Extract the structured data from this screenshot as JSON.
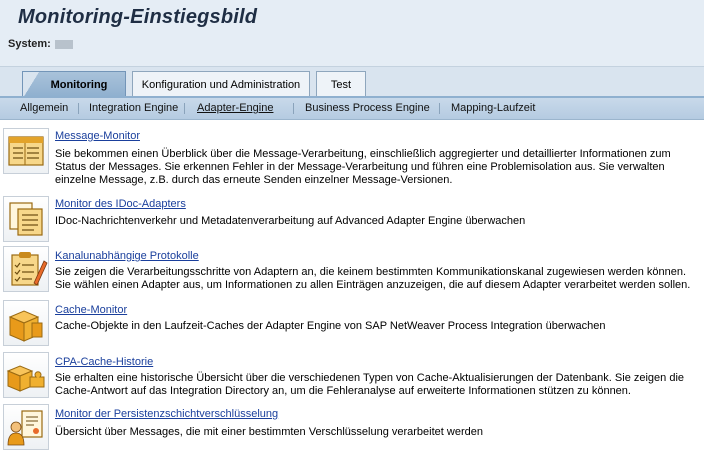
{
  "page": {
    "title": "Monitoring-Einstiegsbild",
    "system_label": "System:",
    "system_value": ""
  },
  "tabs": [
    {
      "label": "Monitoring",
      "active": true
    },
    {
      "label": "Konfiguration und Administration",
      "active": false
    },
    {
      "label": "Test",
      "active": false
    }
  ],
  "subnav": [
    {
      "label": "Allgemein",
      "active": false
    },
    {
      "label": "Integration Engine",
      "active": false
    },
    {
      "label": "Adapter-Engine",
      "active": true
    },
    {
      "label": "Business Process Engine",
      "active": false
    },
    {
      "label": "Mapping-Laufzeit",
      "active": false
    }
  ],
  "entries": [
    {
      "link": "Message-Monitor",
      "icon": "table-icon",
      "description": "Sie bekommen einen Überblick über die Message-Verarbeitung, einschließlich aggregierter und detaillierter Informationen zum Status der Messages. Sie erkennen Fehler in der Message-Verarbeitung und führen eine Problemisolation aus. Sie verwalten einzelne Message, z.B. durch das erneute Senden einzelner Message-Versionen."
    },
    {
      "link": "Monitor des IDoc-Adapters",
      "icon": "documents-icon",
      "description": "IDoc-Nachrichtenverkehr und Metadatenverarbeitung auf Advanced Adapter Engine überwachen"
    },
    {
      "link": "Kanalunabhängige Protokolle",
      "icon": "checklist-pencil-icon",
      "description": "Sie zeigen die Verarbeitungsschritte von Adaptern an, die keinem bestimmten Kommunikationskanal zugewiesen werden können. Sie wählen einen Adapter aus, um Informationen zu allen Einträgen anzuzeigen, die auf diesem Adapter verarbeitet werden sollen."
    },
    {
      "link": "Cache-Monitor",
      "icon": "cache-boxes-icon",
      "description": "Cache-Objekte in den Laufzeit-Caches der Adapter Engine von SAP NetWeaver Process Integration überwachen"
    },
    {
      "link": "CPA-Cache-Historie",
      "icon": "puzzle-boxes-icon",
      "description": "Sie erhalten eine historische Übersicht über die verschiedenen Typen von Cache-Aktualisierungen der Datenbank. Sie zeigen die Cache-Antwort auf das Integration Directory an, um die Fehleranalyse auf erweiterte Informationen stützen zu können."
    },
    {
      "link": "Monitor der Persistenzschichtverschlüsselung",
      "icon": "person-certificate-icon",
      "description": "Übersicht über Messages, die mit einer bestimmten Verschlüsselung verarbeitet werden"
    }
  ],
  "colors": {
    "link": "#1a3f9c",
    "header_bg": "#e5edf5",
    "active_tab": "#8fb0cf",
    "icon_orange": "#f0a020"
  }
}
